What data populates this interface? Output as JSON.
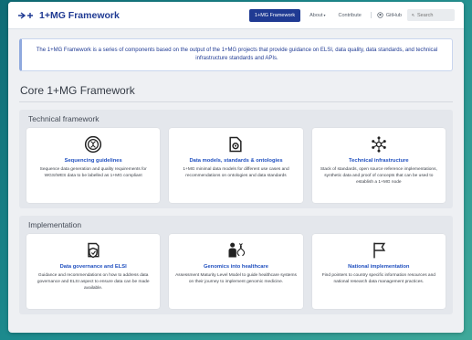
{
  "navbar": {
    "brand": "1+MG Framework",
    "links": [
      {
        "label": "1+MG Framework",
        "active": true,
        "caret": false
      },
      {
        "label": "About",
        "active": false,
        "caret": true
      },
      {
        "label": "Contribute",
        "active": false,
        "caret": false
      }
    ],
    "github_label": "GitHub",
    "search_placeholder": "Search"
  },
  "banner": {
    "text": "The 1+MG Framework is a series of components based on the output of the 1+MG projects that provide guidance on ELSI, data quality, data standards, and technical infrastructure standards and APIs."
  },
  "page_title": "Core 1+MG Framework",
  "sections": [
    {
      "heading": "Technical framework",
      "cards": [
        {
          "icon": "dna-badge-icon",
          "title": "Sequencing guidelines",
          "description": "Sequence data generation and quality requirements for WGS/WES data to be labelled as 1+MG compliant"
        },
        {
          "icon": "data-file-gear-icon",
          "title": "Data models, standards & ontologies",
          "description": "1+MG minimal data models for different use cases and recommendations on ontologies and data standards"
        },
        {
          "icon": "network-hub-icon",
          "title": "Technical infrastructure",
          "description": "Stack of standards, open source reference implementations, synthetic data and proof of concepts that can be used to establish a 1+MG node"
        }
      ]
    },
    {
      "heading": "Implementation",
      "cards": [
        {
          "icon": "shield-document-icon",
          "title": "Data governance and ELSI",
          "description": "Guidance and recommendations on how to address data governance and ELSI aspect to ensure data can be made available."
        },
        {
          "icon": "doctor-dna-icon",
          "title": "Genomics into healthcare",
          "description": "Assessment Maturity Level Model to guide healthcare systems on their journey to implement genomic medicine."
        },
        {
          "icon": "flag-icon",
          "title": "National implementation",
          "description": "Find pointers to country specific information resources and national research data management practices."
        }
      ]
    }
  ],
  "colors": {
    "brand": "#1f3a93",
    "link": "#1f4fbf",
    "background_gradient": "#1d8c8f"
  }
}
